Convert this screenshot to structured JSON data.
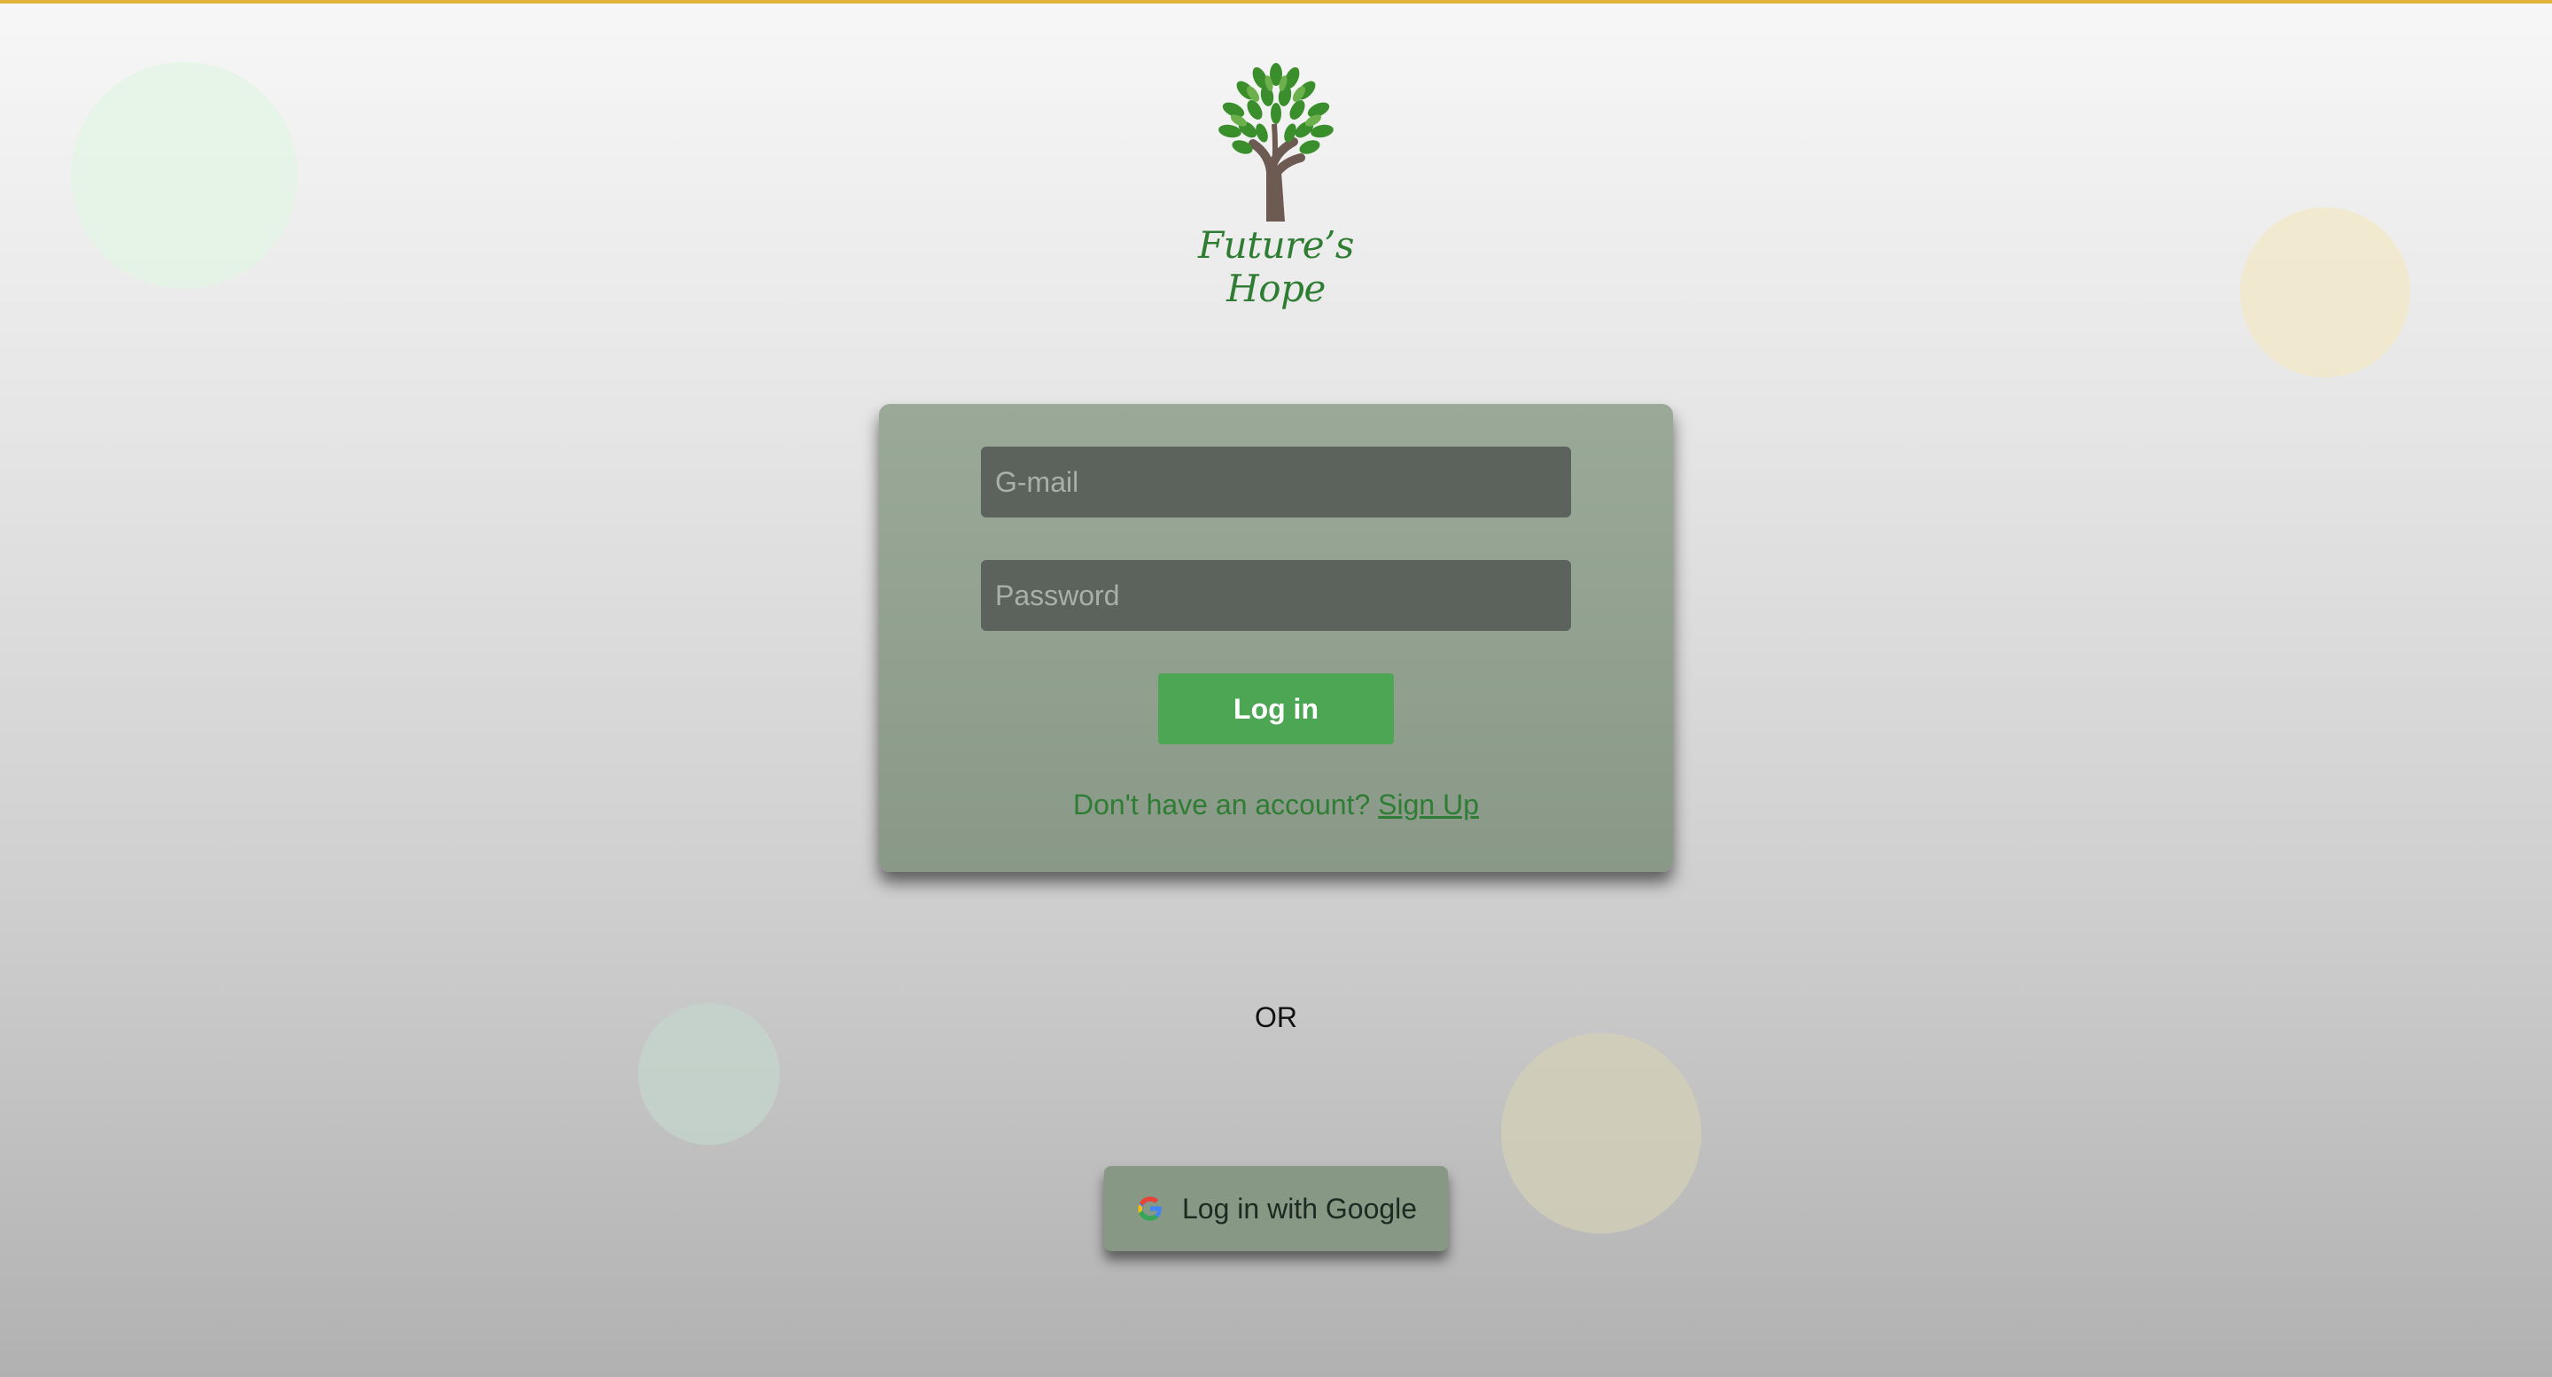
{
  "brand": {
    "name": "Future’s Hope",
    "logo_icon": "tree-icon",
    "accent_color": "#2e7d32"
  },
  "login_form": {
    "email_placeholder": "G-mail",
    "password_placeholder": "Password",
    "login_label": "Log in",
    "signup_prompt": "Don't have an account?",
    "signup_link": "Sign Up"
  },
  "divider": {
    "text": "OR"
  },
  "google_login": {
    "label": "Log in with Google",
    "icon": "google-icon"
  },
  "colors": {
    "top_bar": "#e2b23a",
    "card": "#8f9e8c",
    "input_bg": "#5b635c",
    "login_button": "#4ca653",
    "link": "#2f7d34"
  }
}
